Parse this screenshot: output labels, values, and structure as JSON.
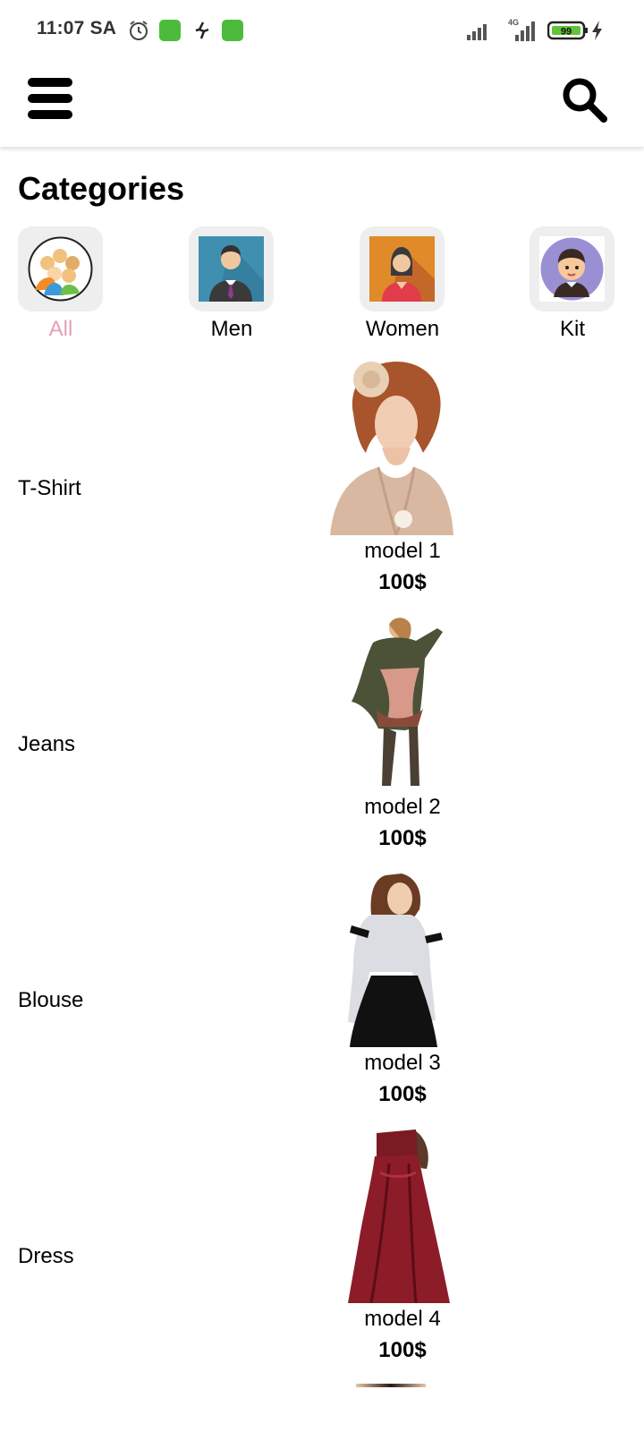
{
  "status_bar": {
    "time": "11:07 SA",
    "network": "4G",
    "battery": "99"
  },
  "app_bar": {
    "menu_icon": "hamburger-menu-icon",
    "search_icon": "search-icon"
  },
  "categories": {
    "title": "Categories",
    "items": [
      {
        "label": "All",
        "icon": "group-avatar-icon",
        "selected": true
      },
      {
        "label": "Men",
        "icon": "man-avatar-icon",
        "selected": false
      },
      {
        "label": "Women",
        "icon": "woman-avatar-icon",
        "selected": false
      },
      {
        "label": "Kit",
        "icon": "kid-avatar-icon",
        "selected": false
      }
    ]
  },
  "products": [
    {
      "category": "T-Shirt",
      "name": "model 1",
      "price": "100$"
    },
    {
      "category": "Jeans",
      "name": "model 2",
      "price": "100$"
    },
    {
      "category": "Blouse",
      "name": "model 3",
      "price": "100$"
    },
    {
      "category": "Dress",
      "name": "model 4",
      "price": "100$"
    }
  ],
  "colors": {
    "selected_category": "#e59fbc",
    "tile_background": "#eeeeee",
    "badge_green": "#4cbb3c"
  }
}
